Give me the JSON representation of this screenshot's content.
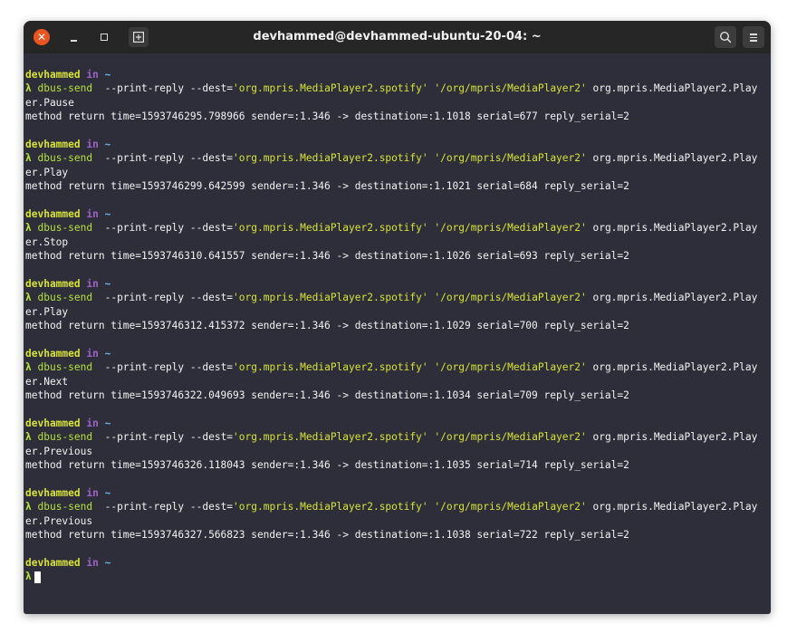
{
  "window": {
    "title": "devhammed@devhammed-ubuntu-20-04: ~",
    "close_glyph": "✕"
  },
  "prompt": {
    "user": "devhammed",
    "in": "in",
    "dir": "~",
    "lambda": "λ"
  },
  "blocks": [
    {
      "cmd": "dbus-send",
      "args": "  --print-reply --dest=",
      "dest": "'org.mpris.MediaPlayer2.spotify'",
      "path": "'/org/mpris/MediaPlayer2'",
      "method_a": " org.mpris.MediaPlayer2.Play",
      "method_b": "er.Pause",
      "output": "method return time=1593746295.798966 sender=:1.346 -> destination=:1.1018 serial=677 reply_serial=2"
    },
    {
      "cmd": "dbus-send",
      "args": "  --print-reply --dest=",
      "dest": "'org.mpris.MediaPlayer2.spotify'",
      "path": "'/org/mpris/MediaPlayer2'",
      "method_a": " org.mpris.MediaPlayer2.Play",
      "method_b": "er.Play",
      "output": "method return time=1593746299.642599 sender=:1.346 -> destination=:1.1021 serial=684 reply_serial=2"
    },
    {
      "cmd": "dbus-send",
      "args": "  --print-reply --dest=",
      "dest": "'org.mpris.MediaPlayer2.spotify'",
      "path": "'/org/mpris/MediaPlayer2'",
      "method_a": " org.mpris.MediaPlayer2.Play",
      "method_b": "er.Stop",
      "output": "method return time=1593746310.641557 sender=:1.346 -> destination=:1.1026 serial=693 reply_serial=2"
    },
    {
      "cmd": "dbus-send",
      "args": "  --print-reply --dest=",
      "dest": "'org.mpris.MediaPlayer2.spotify'",
      "path": "'/org/mpris/MediaPlayer2'",
      "method_a": " org.mpris.MediaPlayer2.Play",
      "method_b": "er.Play",
      "output": "method return time=1593746312.415372 sender=:1.346 -> destination=:1.1029 serial=700 reply_serial=2"
    },
    {
      "cmd": "dbus-send",
      "args": "  --print-reply --dest=",
      "dest": "'org.mpris.MediaPlayer2.spotify'",
      "path": "'/org/mpris/MediaPlayer2'",
      "method_a": " org.mpris.MediaPlayer2.Play",
      "method_b": "er.Next",
      "output": "method return time=1593746322.049693 sender=:1.346 -> destination=:1.1034 serial=709 reply_serial=2"
    },
    {
      "cmd": "dbus-send",
      "args": "  --print-reply --dest=",
      "dest": "'org.mpris.MediaPlayer2.spotify'",
      "path": "'/org/mpris/MediaPlayer2'",
      "method_a": " org.mpris.MediaPlayer2.Play",
      "method_b": "er.Previous",
      "output": "method return time=1593746326.118043 sender=:1.346 -> destination=:1.1035 serial=714 reply_serial=2"
    },
    {
      "cmd": "dbus-send",
      "args": "  --print-reply --dest=",
      "dest": "'org.mpris.MediaPlayer2.spotify'",
      "path": "'/org/mpris/MediaPlayer2'",
      "method_a": " org.mpris.MediaPlayer2.Play",
      "method_b": "er.Previous",
      "output": "method return time=1593746327.566823 sender=:1.346 -> destination=:1.1038 serial=722 reply_serial=2"
    }
  ],
  "colors": {
    "terminal_bg": "#2d2e3a",
    "titlebar_bg": "#262626",
    "close_button": "#e95420",
    "user": "#d8e334",
    "in": "#9e63c7",
    "dir": "#6fb2e6",
    "command": "#b7e23a"
  },
  "icons": {
    "close": "close-icon",
    "minimize": "minimize-icon",
    "maximize": "maximize-icon",
    "new_tab": "new-tab-icon",
    "search": "search-icon",
    "menu": "hamburger-menu-icon"
  }
}
